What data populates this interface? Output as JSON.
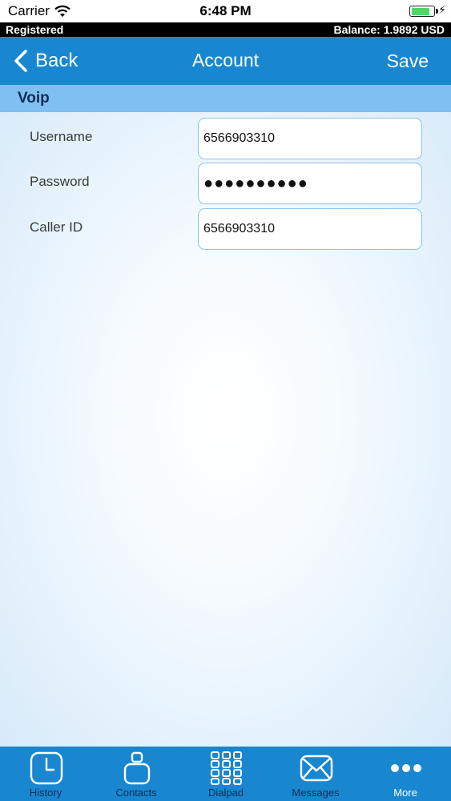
{
  "status_bar": {
    "carrier": "Carrier",
    "time": "6:48 PM",
    "battery_level": 0.85,
    "charging_icon": "⚡"
  },
  "registration": {
    "status": "Registered",
    "balance": "Balance: 1.9892 USD"
  },
  "nav": {
    "back_label": "Back",
    "title": "Account",
    "save_label": "Save"
  },
  "section": {
    "title": "Voip"
  },
  "form": {
    "username": {
      "label": "Username",
      "value": "6566903310"
    },
    "password": {
      "label": "Password",
      "value": "●●●●●●●●●●"
    },
    "caller_id": {
      "label": "Caller ID",
      "value": "6566903310"
    }
  },
  "tabs": [
    {
      "label": "History",
      "icon": "clock-icon"
    },
    {
      "label": "Contacts",
      "icon": "person-icon"
    },
    {
      "label": "Dialpad",
      "icon": "dialpad-icon"
    },
    {
      "label": "Messages",
      "icon": "envelope-icon"
    },
    {
      "label": "More",
      "icon": "more-dots-icon",
      "active": true
    }
  ],
  "colors": {
    "nav_blue": "#1987d0",
    "section_header": "#80bff2",
    "field_border": "#8cc4ec",
    "tab_label": "#0d2c56"
  }
}
